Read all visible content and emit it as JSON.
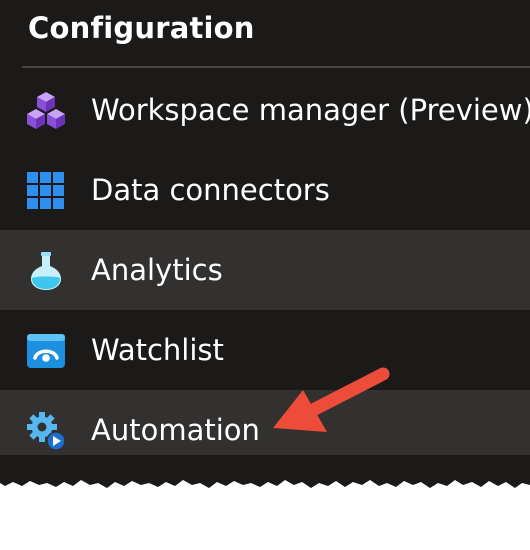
{
  "section": {
    "title": "Configuration"
  },
  "menu": {
    "items": [
      {
        "label": "Workspace manager (Preview)",
        "icon": "cubes-icon"
      },
      {
        "label": "Data connectors",
        "icon": "grid-icon"
      },
      {
        "label": "Analytics",
        "icon": "flask-icon",
        "highlighted": true
      },
      {
        "label": "Watchlist",
        "icon": "eye-gauge-icon"
      },
      {
        "label": "Automation",
        "icon": "gear-play-icon",
        "highlighted": true
      }
    ]
  },
  "annotation": {
    "pointer": "red-arrow-icon",
    "color": "#ee4c3a"
  },
  "colors": {
    "panel_background": "#1b1a19",
    "shaded_row": "#323130",
    "text": "#ffffff"
  }
}
